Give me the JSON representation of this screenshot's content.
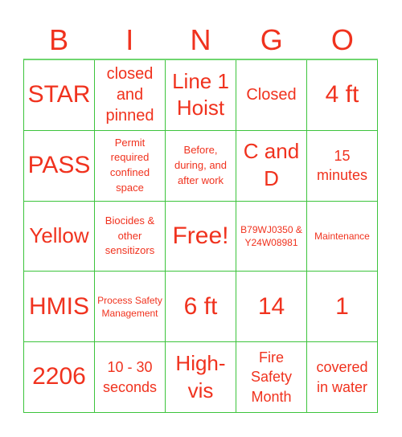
{
  "header": {
    "letters": [
      "B",
      "I",
      "N",
      "G",
      "O"
    ]
  },
  "colors": {
    "text": "#f0321e",
    "grid_line": "#3cc43c"
  },
  "cells": [
    [
      "STAR",
      "closed and pinned",
      "Line 1 Hoist",
      "Closed",
      "4 ft"
    ],
    [
      "PASS",
      "Permit required confined space",
      "Before, during, and after work",
      "C and D",
      "15 minutes"
    ],
    [
      "Yellow",
      "Biocides & other sensitizors",
      "Free!",
      "B79WJ0350 & Y24W08981",
      "Maintenance"
    ],
    [
      "HMIS",
      "Process Safety Management",
      "6 ft",
      "14",
      "1"
    ],
    [
      "2206",
      "10 - 30 seconds",
      "High-vis",
      "Fire Safety Month",
      "covered in water"
    ]
  ]
}
